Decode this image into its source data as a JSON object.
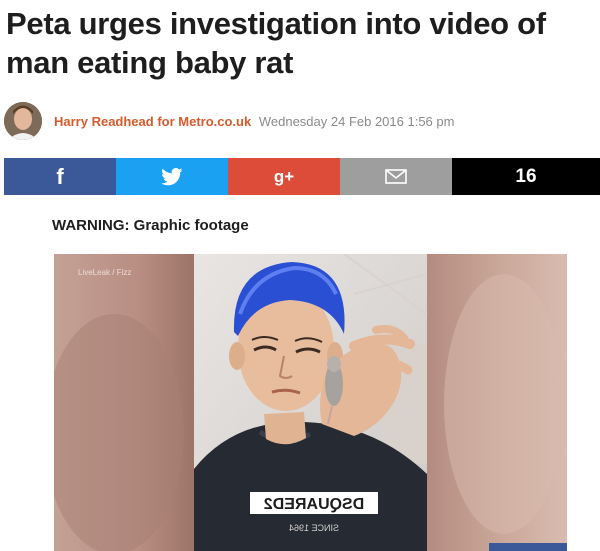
{
  "article": {
    "headline": "Peta urges investigation into video of man eating baby rat",
    "author": "Harry Readhead for Metro.co.uk",
    "date": "Wednesday 24 Feb 2016 1:56 pm"
  },
  "share": {
    "facebook_icon": "f",
    "googleplus_icon": "g+",
    "count": "16",
    "icons": [
      "facebook-icon",
      "twitter-icon",
      "googleplus-icon",
      "email-icon"
    ],
    "colors": {
      "facebook": "#3b5998",
      "twitter": "#1ba1f1",
      "googleplus": "#dd4b39",
      "email": "#9e9e9e",
      "count": "#000000"
    }
  },
  "warning": "WARNING: Graphic footage",
  "video": {
    "watermark": "LiveLeak / Fizz",
    "shirt_text": "DSQUARED2",
    "shirt_subtext": "SINCE 1964"
  },
  "colors": {
    "author": "#d45c2c",
    "date": "#8a8a8a",
    "headline": "#1e1e1e"
  }
}
